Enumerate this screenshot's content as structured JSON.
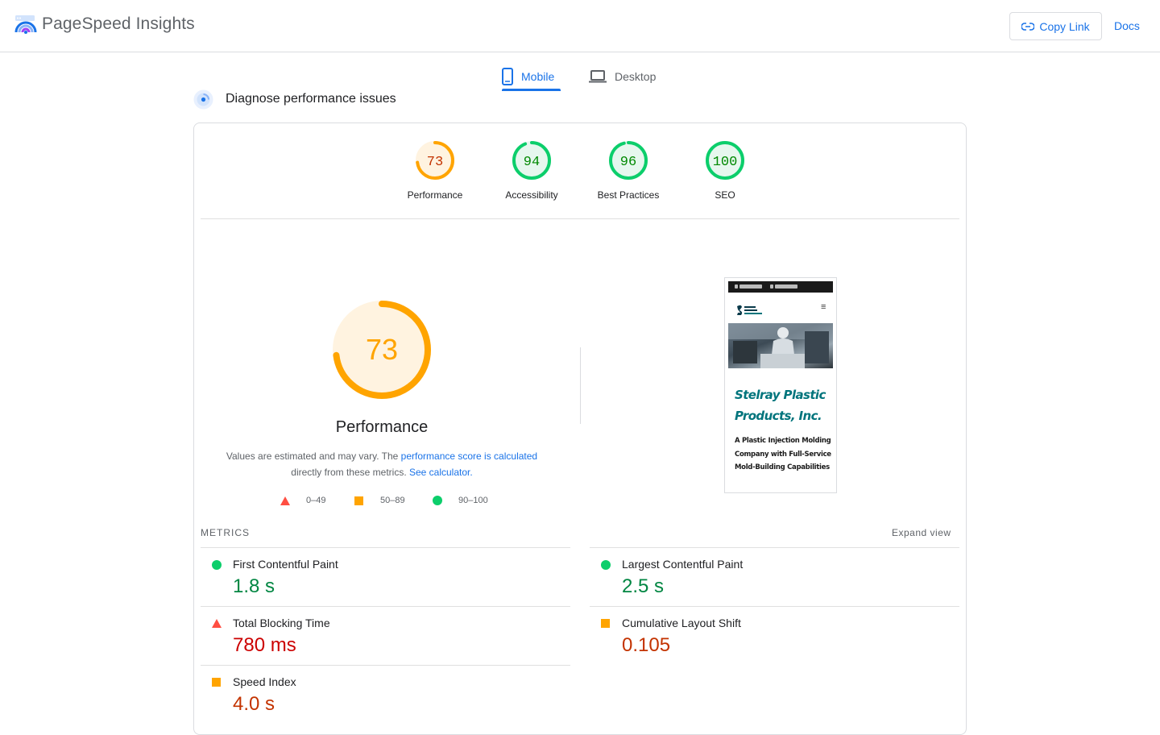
{
  "header": {
    "brand": "PageSpeed Insights",
    "copy_link": "Copy Link",
    "docs": "Docs"
  },
  "tabs": [
    {
      "label": "Mobile",
      "selected": true
    },
    {
      "label": "Desktop",
      "selected": false
    }
  ],
  "section_title": "Diagnose performance issues",
  "colors": {
    "accent": "#1a73e8",
    "pass": "#0cce6b",
    "average": "#ffa400",
    "fail": "#ff4e42"
  },
  "categories": [
    {
      "label": "Performance",
      "score": 73,
      "status": "average"
    },
    {
      "label": "Accessibility",
      "score": 94,
      "status": "pass"
    },
    {
      "label": "Best Practices",
      "score": 96,
      "status": "pass"
    },
    {
      "label": "SEO",
      "score": 100,
      "status": "pass"
    }
  ],
  "performance": {
    "score": 73,
    "title": "Performance",
    "note_prefix": "Values are estimated and may vary. The ",
    "note_link1": "performance score is calculated",
    "note_middle": " directly from these metrics. ",
    "note_link2": "See calculator."
  },
  "legend": [
    {
      "range": "0–49",
      "icon": "triangle-icon"
    },
    {
      "range": "50–89",
      "icon": "square-icon"
    },
    {
      "range": "90–100",
      "icon": "circle-icon"
    }
  ],
  "screenshot": {
    "headline": "Stelray Plastic Products, Inc.",
    "subhead": "A Plastic Injection Molding Company with Full-Service Mold-Building Capabilities"
  },
  "metrics_section": {
    "label": "METRICS",
    "expand": "Expand view",
    "items": [
      {
        "name": "First Contentful Paint",
        "value": "1.8 s",
        "status": "pass"
      },
      {
        "name": "Largest Contentful Paint",
        "value": "2.5 s",
        "status": "pass"
      },
      {
        "name": "Total Blocking Time",
        "value": "780 ms",
        "status": "fail"
      },
      {
        "name": "Cumulative Layout Shift",
        "value": "0.105",
        "status": "average"
      },
      {
        "name": "Speed Index",
        "value": "4.0 s",
        "status": "average"
      }
    ]
  }
}
